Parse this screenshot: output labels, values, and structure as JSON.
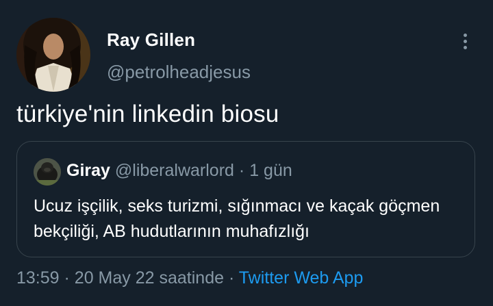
{
  "tweet": {
    "author": {
      "name": "Ray Gillen",
      "handle": "@petrolheadjesus"
    },
    "text": "türkiye'nin linkedin biosu",
    "quoted": {
      "name": "Giray",
      "handle": "@liberalwarlord",
      "separator": "·",
      "time": "1 gün",
      "text": "Ucuz işçilik, seks turizmi, sığınmacı ve kaçak göçmen bekçiliği, AB hudutlarının muhafızlığı"
    },
    "meta": {
      "time": "13:59",
      "separator": "·",
      "date": "20 May 22 saatinde",
      "source_separator": "·",
      "source": "Twitter Web App"
    }
  },
  "colors": {
    "background": "#15202b",
    "primary_text": "#ffffff",
    "secondary_text": "#8899a6",
    "border": "#38444d",
    "link": "#1d9bf0"
  },
  "icons": {
    "more": "more-vertical-icon"
  }
}
